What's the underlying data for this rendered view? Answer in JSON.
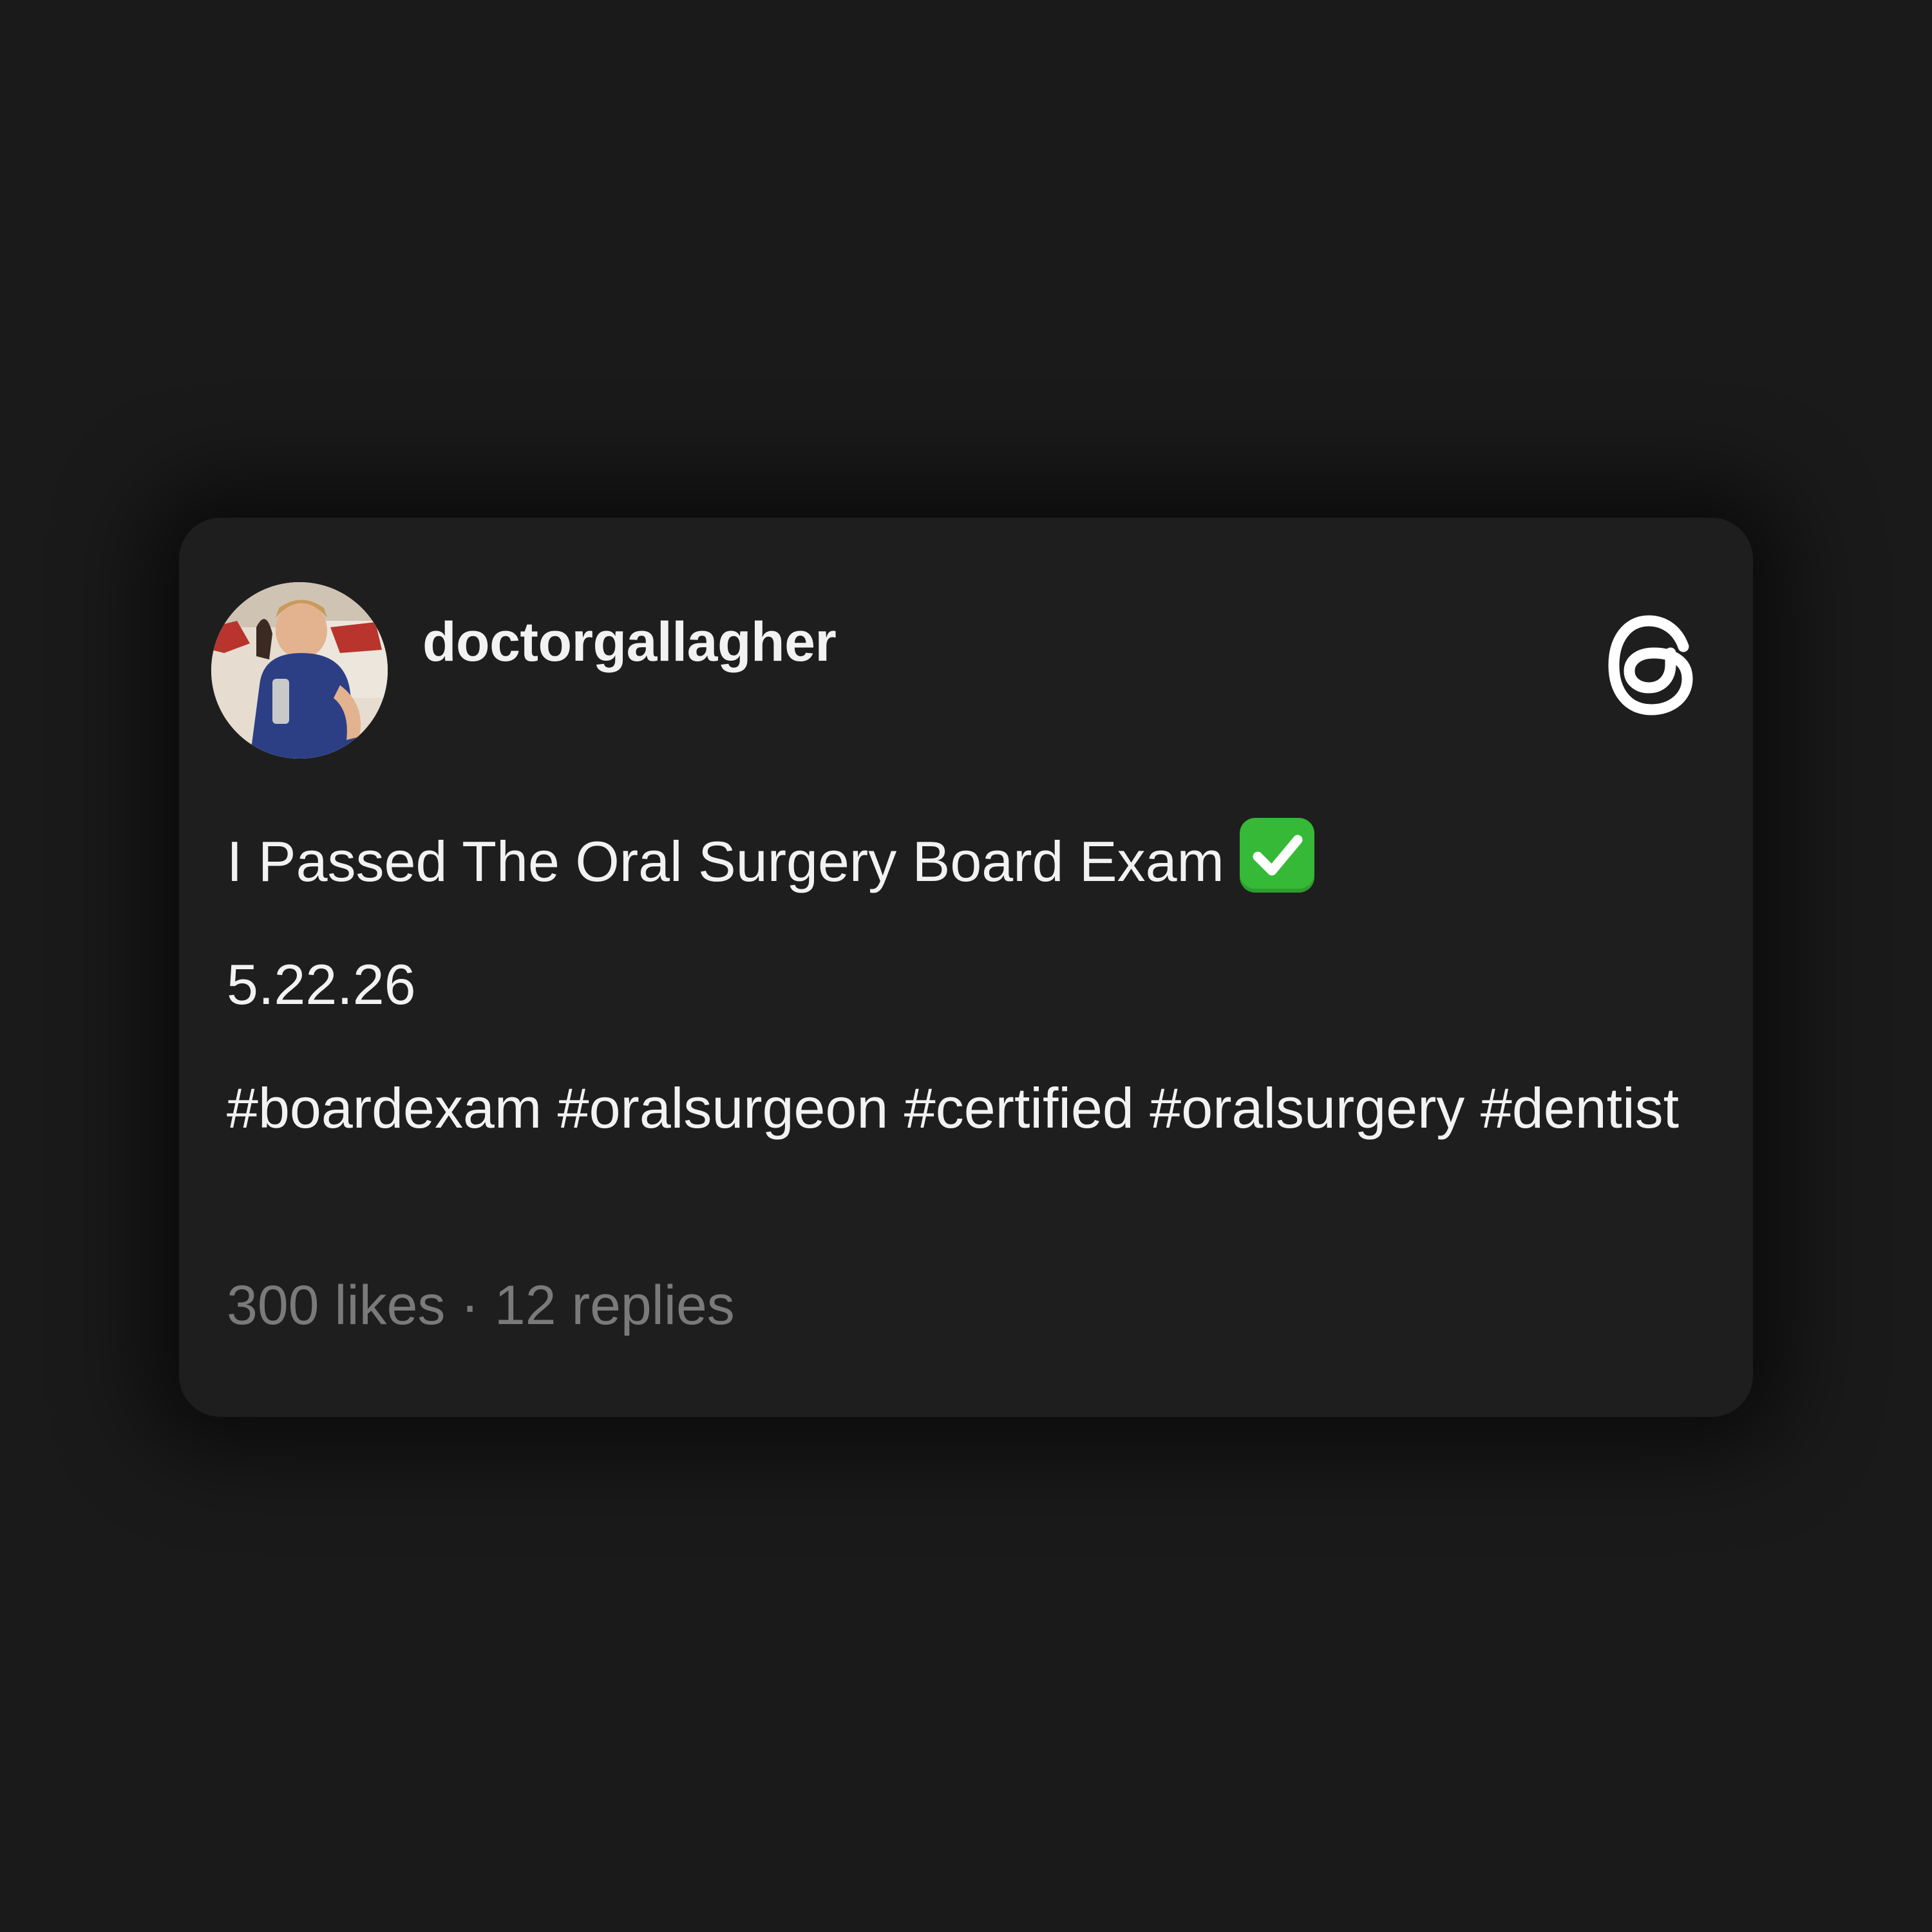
{
  "post": {
    "username": "doctorgallagher",
    "avatar": "avatar-photo",
    "title_text": "I Passed The Oral Surgery Board Exam",
    "title_emoji": "check-mark-button-emoji",
    "date": "5.22.26",
    "hashtags": "#boardexam #oralsurgeon #certified #oralsurgery #dentist",
    "likes": "300 likes",
    "separator": "·",
    "replies": "12 replies"
  },
  "brand": {
    "icon": "threads-logo-icon"
  },
  "colors": {
    "background": "#1a1a1a",
    "card": "#1e1e1e",
    "text_primary": "#f2f2f2",
    "text_secondary": "#7a7a7a",
    "check_green": "#35b936"
  }
}
